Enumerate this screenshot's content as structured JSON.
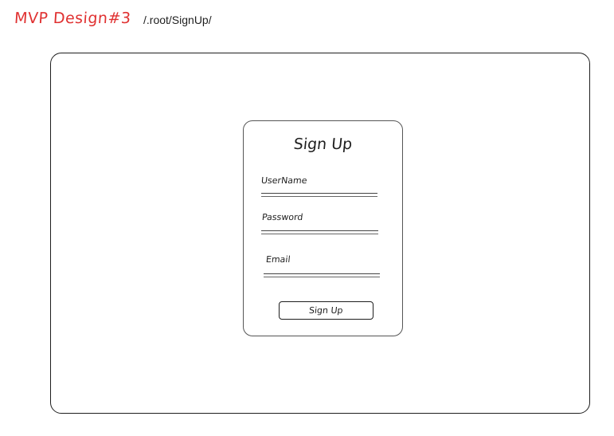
{
  "header": {
    "title": "MVP Design#3",
    "path": "/.root/SignUp/"
  },
  "signup_form": {
    "title": "Sign Up",
    "fields": [
      {
        "label": "UserName",
        "value": ""
      },
      {
        "label": "Password",
        "value": ""
      },
      {
        "label": "Email",
        "value": ""
      }
    ],
    "submit_label": "Sign Up"
  },
  "colors": {
    "header_title": "#e03131",
    "stroke": "#1e1e1e"
  }
}
